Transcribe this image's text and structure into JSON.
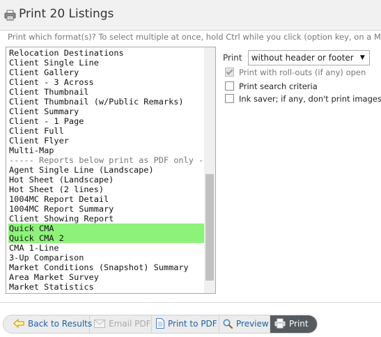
{
  "header": {
    "title": "Print 20 Listings",
    "icon": "printer-icon"
  },
  "instructions": "Print which format(s)? To select multiple at once, hold Ctrl while you click (option key, on a Mac)",
  "formats": [
    "Relocation Destinations",
    "Client Single Line",
    "Client Gallery",
    "Client - 3 Across",
    "Client Thumbnail",
    "Client Thumbnail (w/Public Remarks)",
    "Client Summary",
    "Client - 1 Page",
    "Client Full",
    "Client Flyer",
    "Multi-Map",
    "----- Reports below print as PDF only -----",
    "Agent Single Line (Landscape)",
    "Hot Sheet (Landscape)",
    "Hot Sheet (2 lines)",
    "1004MC Report Detail",
    "1004MC Report Summary",
    "Client Showing Report",
    "Quick CMA",
    "Quick CMA 2",
    "CMA 1-Line",
    "3-Up Comparison",
    "Market Conditions (Snapshot) Summary",
    "Area Market Survey",
    "Market Statistics"
  ],
  "selected_formats": [
    "Quick CMA",
    "Quick CMA 2"
  ],
  "colors": {
    "selection": "#8df27a",
    "active_button": "#555b5e",
    "link": "#1e5fa8"
  },
  "options": {
    "print_label": "Print",
    "print_select_value": "without header or footer",
    "rollouts_label": "Print with roll-outs (if any) open",
    "rollouts_checked": true,
    "search_criteria_label": "Print search criteria",
    "search_criteria_checked": false,
    "ink_saver_label": "Ink saver; if any, don't print images",
    "ink_saver_checked": false
  },
  "toolbar": {
    "back_label": "Back to Results",
    "email_label": "Email PDF",
    "pdf_label": "Print to PDF",
    "preview_label": "Preview",
    "print_label": "Print"
  }
}
